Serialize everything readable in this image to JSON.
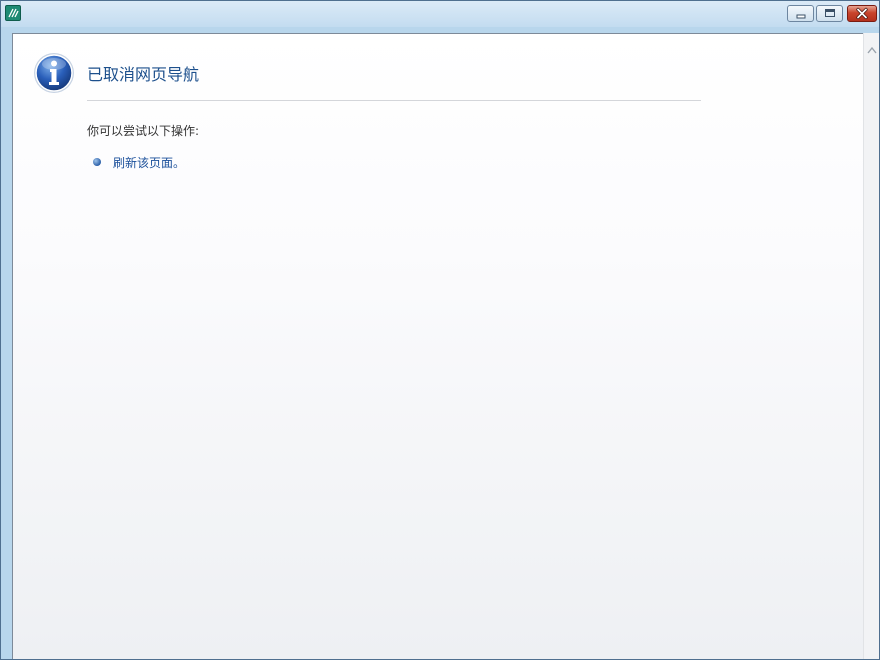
{
  "window": {
    "icon": "app-icon",
    "controls": {
      "minimize_icon": "minimize-icon",
      "maximize_icon": "maximize-icon",
      "close_icon": "close-icon"
    }
  },
  "page": {
    "icon": "info-icon",
    "title": "已取消网页导航",
    "subtitle": "你可以尝试以下操作:",
    "actions": [
      {
        "label": "刷新该页面。"
      }
    ]
  },
  "colors": {
    "title": "#1c4f8c",
    "link": "#1a4f9a",
    "close_button": "#c9442c",
    "titlebar": "#c3dcf0"
  }
}
